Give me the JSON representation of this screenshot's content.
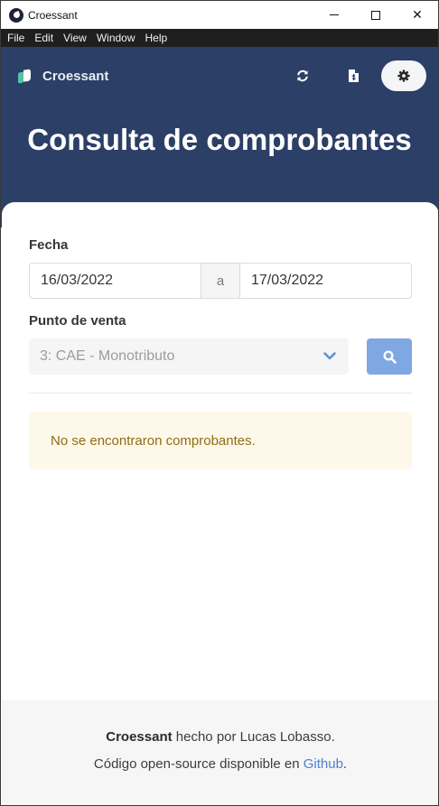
{
  "window": {
    "title": "Croessant",
    "controls": {
      "minimize": "minimize-icon",
      "maximize": "maximize-icon",
      "close": "✕"
    }
  },
  "menu": {
    "items": [
      "File",
      "Edit",
      "View",
      "Window",
      "Help"
    ]
  },
  "header": {
    "brand": "Croessant",
    "nav_icons": [
      "refresh-icon",
      "file-invoice-icon",
      "gear-icon"
    ],
    "title": "Consulta de comprobantes"
  },
  "form": {
    "date_label": "Fecha",
    "date_from": "16/03/2022",
    "date_separator": "a",
    "date_to": "17/03/2022",
    "pos_label": "Punto de venta",
    "pos_selected": "3: CAE - Monotributo"
  },
  "notice": {
    "text": "No se encontraron comprobantes."
  },
  "footer": {
    "brand": "Croessant",
    "credit": " hecho por Lucas Lobasso.",
    "source_prefix": "Código open-source disponible en ",
    "source_link": "Github",
    "source_suffix": "."
  },
  "colors": {
    "hero_bg": "#2c3f66",
    "search_button": "#7fa7e2",
    "notice_bg": "#fef8ea",
    "notice_text": "#8f6d14",
    "link": "#4a7fd0"
  }
}
